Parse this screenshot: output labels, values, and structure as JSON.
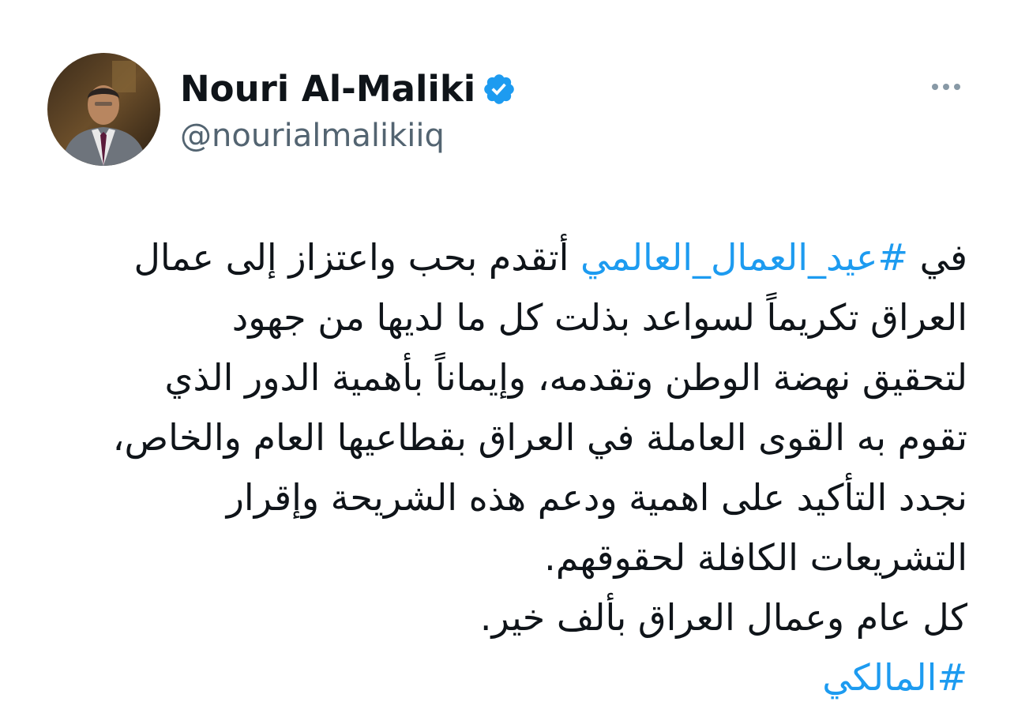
{
  "author": {
    "display_name": "Nouri Al-Maliki",
    "handle": "@nourialmalikiiq",
    "verified": true,
    "avatar_icon": "profile-photo"
  },
  "menu": {
    "icon": "more-horizontal-icon"
  },
  "tweet": {
    "line1_prefix": "في ",
    "hashtag1": "#عيد_العمال_العالمي",
    "line1_suffix": " أتقدم بحب واعتزاز إلى عمال",
    "line2": "العراق تكريماً لسواعد بذلت كل ما لديها من جهود",
    "line3": "لتحقيق نهضة الوطن وتقدمه، وإيماناً بأهمية الدور الذي",
    "line4": "تقوم به القوى العاملة في العراق بقطاعيها العام والخاص،",
    "line5": "نجدد التأكيد على اهمية ودعم هذه الشريحة وإقرار",
    "line6": "التشريعات الكافلة لحقوقهم.",
    "line7": "كل عام وعمال العراق بألف خير.",
    "hashtag2": "#المالكي"
  },
  "colors": {
    "text": "#0f1419",
    "secondary": "#536471",
    "link": "#1d9bf0",
    "verified_badge": "#1d9bf0"
  }
}
